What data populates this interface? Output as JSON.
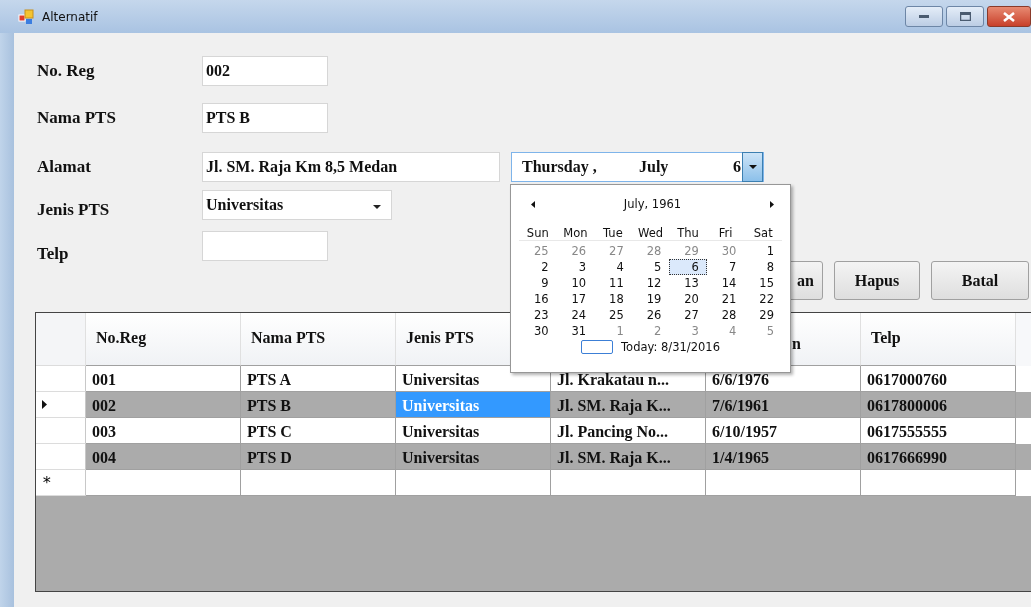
{
  "window": {
    "title": "Alternatif"
  },
  "form": {
    "fields": [
      {
        "label": "No. Reg",
        "kind": "text",
        "value": "002"
      },
      {
        "label": "Nama PTS",
        "kind": "text",
        "value": "PTS B"
      },
      {
        "label": "Alamat",
        "kind": "wide",
        "value": "Jl. SM. Raja Km 8,5 Medan"
      },
      {
        "label": "Jenis PTS",
        "kind": "combo",
        "value": "Universitas"
      },
      {
        "label": "Telp",
        "kind": "text"
      }
    ]
  },
  "date_picker": {
    "parts": [
      "Thursday ,",
      "July",
      "6"
    ],
    "expanded": true
  },
  "calendar": {
    "title": "July, 1961",
    "weekdays": [
      "Sun",
      "Mon",
      "Tue",
      "Wed",
      "Thu",
      "Fri",
      "Sat"
    ],
    "days": [
      {
        "d": "25",
        "other": true,
        "selected": false
      },
      {
        "d": "26",
        "other": true,
        "selected": false
      },
      {
        "d": "27",
        "other": true,
        "selected": false
      },
      {
        "d": "28",
        "other": true,
        "selected": false
      },
      {
        "d": "29",
        "other": true,
        "selected": false
      },
      {
        "d": "30",
        "other": true,
        "selected": false
      },
      {
        "d": "1",
        "other": false,
        "selected": false
      },
      {
        "d": "2",
        "other": false,
        "selected": false
      },
      {
        "d": "3",
        "other": false,
        "selected": false
      },
      {
        "d": "4",
        "other": false,
        "selected": false
      },
      {
        "d": "5",
        "other": false,
        "selected": false
      },
      {
        "d": "6",
        "other": false,
        "selected": true
      },
      {
        "d": "7",
        "other": false,
        "selected": false
      },
      {
        "d": "8",
        "other": false,
        "selected": false
      },
      {
        "d": "9",
        "other": false,
        "selected": false
      },
      {
        "d": "10",
        "other": false,
        "selected": false
      },
      {
        "d": "11",
        "other": false,
        "selected": false
      },
      {
        "d": "12",
        "other": false,
        "selected": false
      },
      {
        "d": "13",
        "other": false,
        "selected": false
      },
      {
        "d": "14",
        "other": false,
        "selected": false
      },
      {
        "d": "15",
        "other": false,
        "selected": false
      },
      {
        "d": "16",
        "other": false,
        "selected": false
      },
      {
        "d": "17",
        "other": false,
        "selected": false
      },
      {
        "d": "18",
        "other": false,
        "selected": false
      },
      {
        "d": "19",
        "other": false,
        "selected": false
      },
      {
        "d": "20",
        "other": false,
        "selected": false
      },
      {
        "d": "21",
        "other": false,
        "selected": false
      },
      {
        "d": "22",
        "other": false,
        "selected": false
      },
      {
        "d": "23",
        "other": false,
        "selected": false
      },
      {
        "d": "24",
        "other": false,
        "selected": false
      },
      {
        "d": "25",
        "other": false,
        "selected": false
      },
      {
        "d": "26",
        "other": false,
        "selected": false
      },
      {
        "d": "27",
        "other": false,
        "selected": false
      },
      {
        "d": "28",
        "other": false,
        "selected": false
      },
      {
        "d": "29",
        "other": false,
        "selected": false
      },
      {
        "d": "30",
        "other": false,
        "selected": false
      },
      {
        "d": "31",
        "other": false,
        "selected": false
      },
      {
        "d": "1",
        "other": true,
        "selected": false
      },
      {
        "d": "2",
        "other": true,
        "selected": false
      },
      {
        "d": "3",
        "other": true,
        "selected": false
      },
      {
        "d": "4",
        "other": true,
        "selected": false
      },
      {
        "d": "5",
        "other": true,
        "selected": false
      }
    ],
    "today": "Today: 8/31/2016"
  },
  "buttons": [
    "an",
    "Hapus",
    "Batal"
  ],
  "table": {
    "columns": [
      "No.Reg",
      "Nama PTS",
      "Jenis PTS",
      null,
      "n",
      "Telp"
    ],
    "rows": [
      {
        "current": false,
        "alternate": false,
        "cells": [
          {
            "text": "001",
            "selected": false
          },
          {
            "text": "PTS A",
            "selected": false
          },
          {
            "text": "Universitas",
            "selected": false
          },
          {
            "text": "Jl. Krakatau n...",
            "selected": false
          },
          {
            "text": "6/6/1976",
            "selected": false
          },
          {
            "text": "0617000760",
            "selected": false
          }
        ]
      },
      {
        "current": true,
        "alternate": true,
        "cells": [
          {
            "text": "002",
            "selected": false
          },
          {
            "text": "PTS B",
            "selected": false
          },
          {
            "text": "Universitas",
            "selected": true
          },
          {
            "text": "Jl. SM. Raja K...",
            "selected": false
          },
          {
            "text": "7/6/1961",
            "selected": false
          },
          {
            "text": "0617800006",
            "selected": false
          }
        ]
      },
      {
        "current": false,
        "alternate": false,
        "cells": [
          {
            "text": "003",
            "selected": false
          },
          {
            "text": "PTS C",
            "selected": false
          },
          {
            "text": "Universitas",
            "selected": false
          },
          {
            "text": "Jl. Pancing No...",
            "selected": false
          },
          {
            "text": "6/10/1957",
            "selected": false
          },
          {
            "text": "0617555555",
            "selected": false
          }
        ]
      },
      {
        "current": false,
        "alternate": true,
        "cells": [
          {
            "text": "004",
            "selected": false
          },
          {
            "text": "PTS D",
            "selected": false
          },
          {
            "text": "Universitas",
            "selected": false
          },
          {
            "text": "Jl. SM. Raja K...",
            "selected": false
          },
          {
            "text": "1/4/1965",
            "selected": false
          },
          {
            "text": "0617666990",
            "selected": false
          }
        ]
      }
    ],
    "new_row": {
      "marker": "*"
    }
  }
}
